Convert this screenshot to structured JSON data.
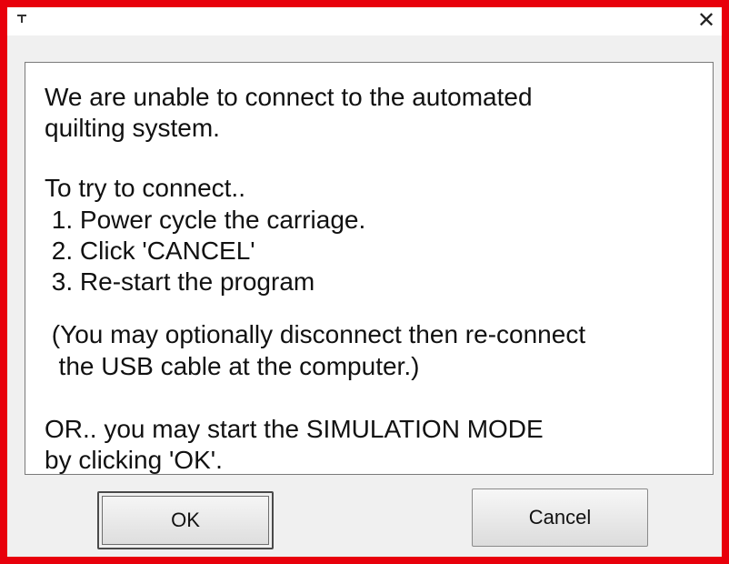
{
  "window": {
    "close_glyph": "✕"
  },
  "message": {
    "lines": [
      "We are unable to connect to the automated",
      "quilting system.",
      "To try to connect..",
      " 1. Power cycle the carriage.",
      " 2. Click 'CANCEL'",
      " 3. Re-start the program",
      " (You may optionally disconnect then re-connect",
      "  the USB cable at the computer.)",
      "OR.. you may start the SIMULATION MODE",
      "by clicking 'OK'."
    ]
  },
  "buttons": {
    "ok_label": "OK",
    "cancel_label": "Cancel"
  },
  "colors": {
    "highlight_border": "#e8000b",
    "dialog_background": "#f0f0f0"
  }
}
